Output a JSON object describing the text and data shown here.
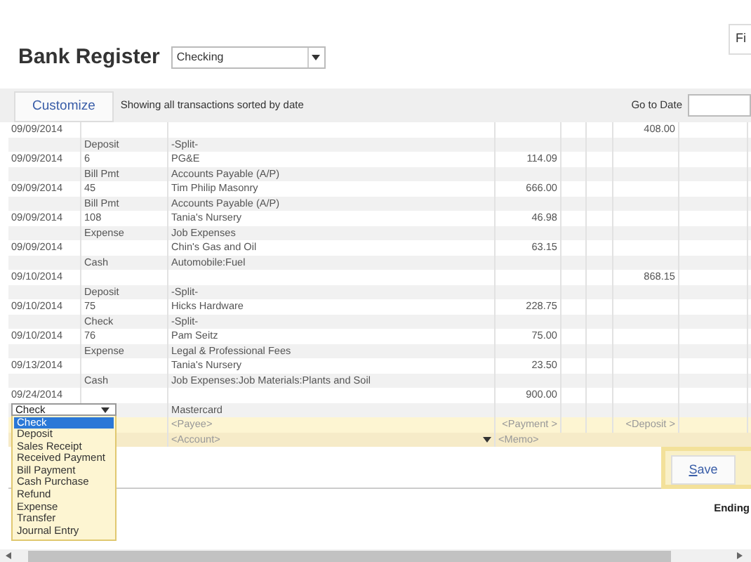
{
  "header": {
    "title": "Bank Register",
    "account_select": "Checking",
    "find_button": "Fi"
  },
  "toolbar": {
    "customize_button": "Customize",
    "description": "Showing all transactions sorted by date",
    "go_to_date_label": "Go to Date"
  },
  "transactions": [
    {
      "date": "09/09/2014",
      "type": "Deposit",
      "account": "-Split-",
      "deposit": "408.00"
    },
    {
      "date": "09/09/2014",
      "ref": "6",
      "payee": "PG&E",
      "type": "Bill Pmt",
      "account": "Accounts Payable (A/P)",
      "payment": "114.09"
    },
    {
      "date": "09/09/2014",
      "ref": "45",
      "payee": "Tim Philip Masonry",
      "type": "Bill Pmt",
      "account": "Accounts Payable (A/P)",
      "payment": "666.00"
    },
    {
      "date": "09/09/2014",
      "ref": "108",
      "payee": "Tania's Nursery",
      "type": "Expense",
      "account": "Job Expenses",
      "payment": "46.98"
    },
    {
      "date": "09/09/2014",
      "payee": "Chin's Gas and Oil",
      "type": "Cash",
      "account": "Automobile:Fuel",
      "payment": "63.15"
    },
    {
      "date": "09/10/2014",
      "type": "Deposit",
      "account": "-Split-",
      "deposit": "868.15"
    },
    {
      "date": "09/10/2014",
      "ref": "75",
      "payee": "Hicks Hardware",
      "type": "Check",
      "account": "-Split-",
      "payment": "228.75"
    },
    {
      "date": "09/10/2014",
      "ref": "76",
      "payee": "Pam Seitz",
      "type": "Expense",
      "account": "Legal & Professional Fees",
      "payment": "75.00"
    },
    {
      "date": "09/13/2014",
      "payee": "Tania's Nursery",
      "type": "Cash",
      "account": "Job Expenses:Job Materials:Plants and Soil",
      "payment": "23.50"
    },
    {
      "date": "09/24/2014",
      "account": "Mastercard",
      "payment": "900.00"
    }
  ],
  "type_dropdown": {
    "value": "Check",
    "options": [
      {
        "label": "Check",
        "selected": true
      },
      {
        "label": "Deposit",
        "selected": false
      },
      {
        "label": "Sales Receipt",
        "selected": false
      },
      {
        "label": "Received Payment",
        "selected": false
      },
      {
        "label": "Bill Payment",
        "selected": false
      },
      {
        "label": "Cash Purchase",
        "selected": false
      },
      {
        "label": "Refund",
        "selected": false
      },
      {
        "label": "Expense",
        "selected": false
      },
      {
        "label": "Transfer",
        "selected": false
      },
      {
        "label": "Journal Entry",
        "selected": false
      }
    ]
  },
  "new_entry": {
    "payee_placeholder": "<Payee>",
    "payment_placeholder": "<Payment >",
    "deposit_placeholder": "<Deposit >",
    "account_placeholder": "<Account>",
    "memo_placeholder": "<Memo>"
  },
  "save_button": "Save",
  "footer": {
    "ending_label": "Ending"
  }
}
